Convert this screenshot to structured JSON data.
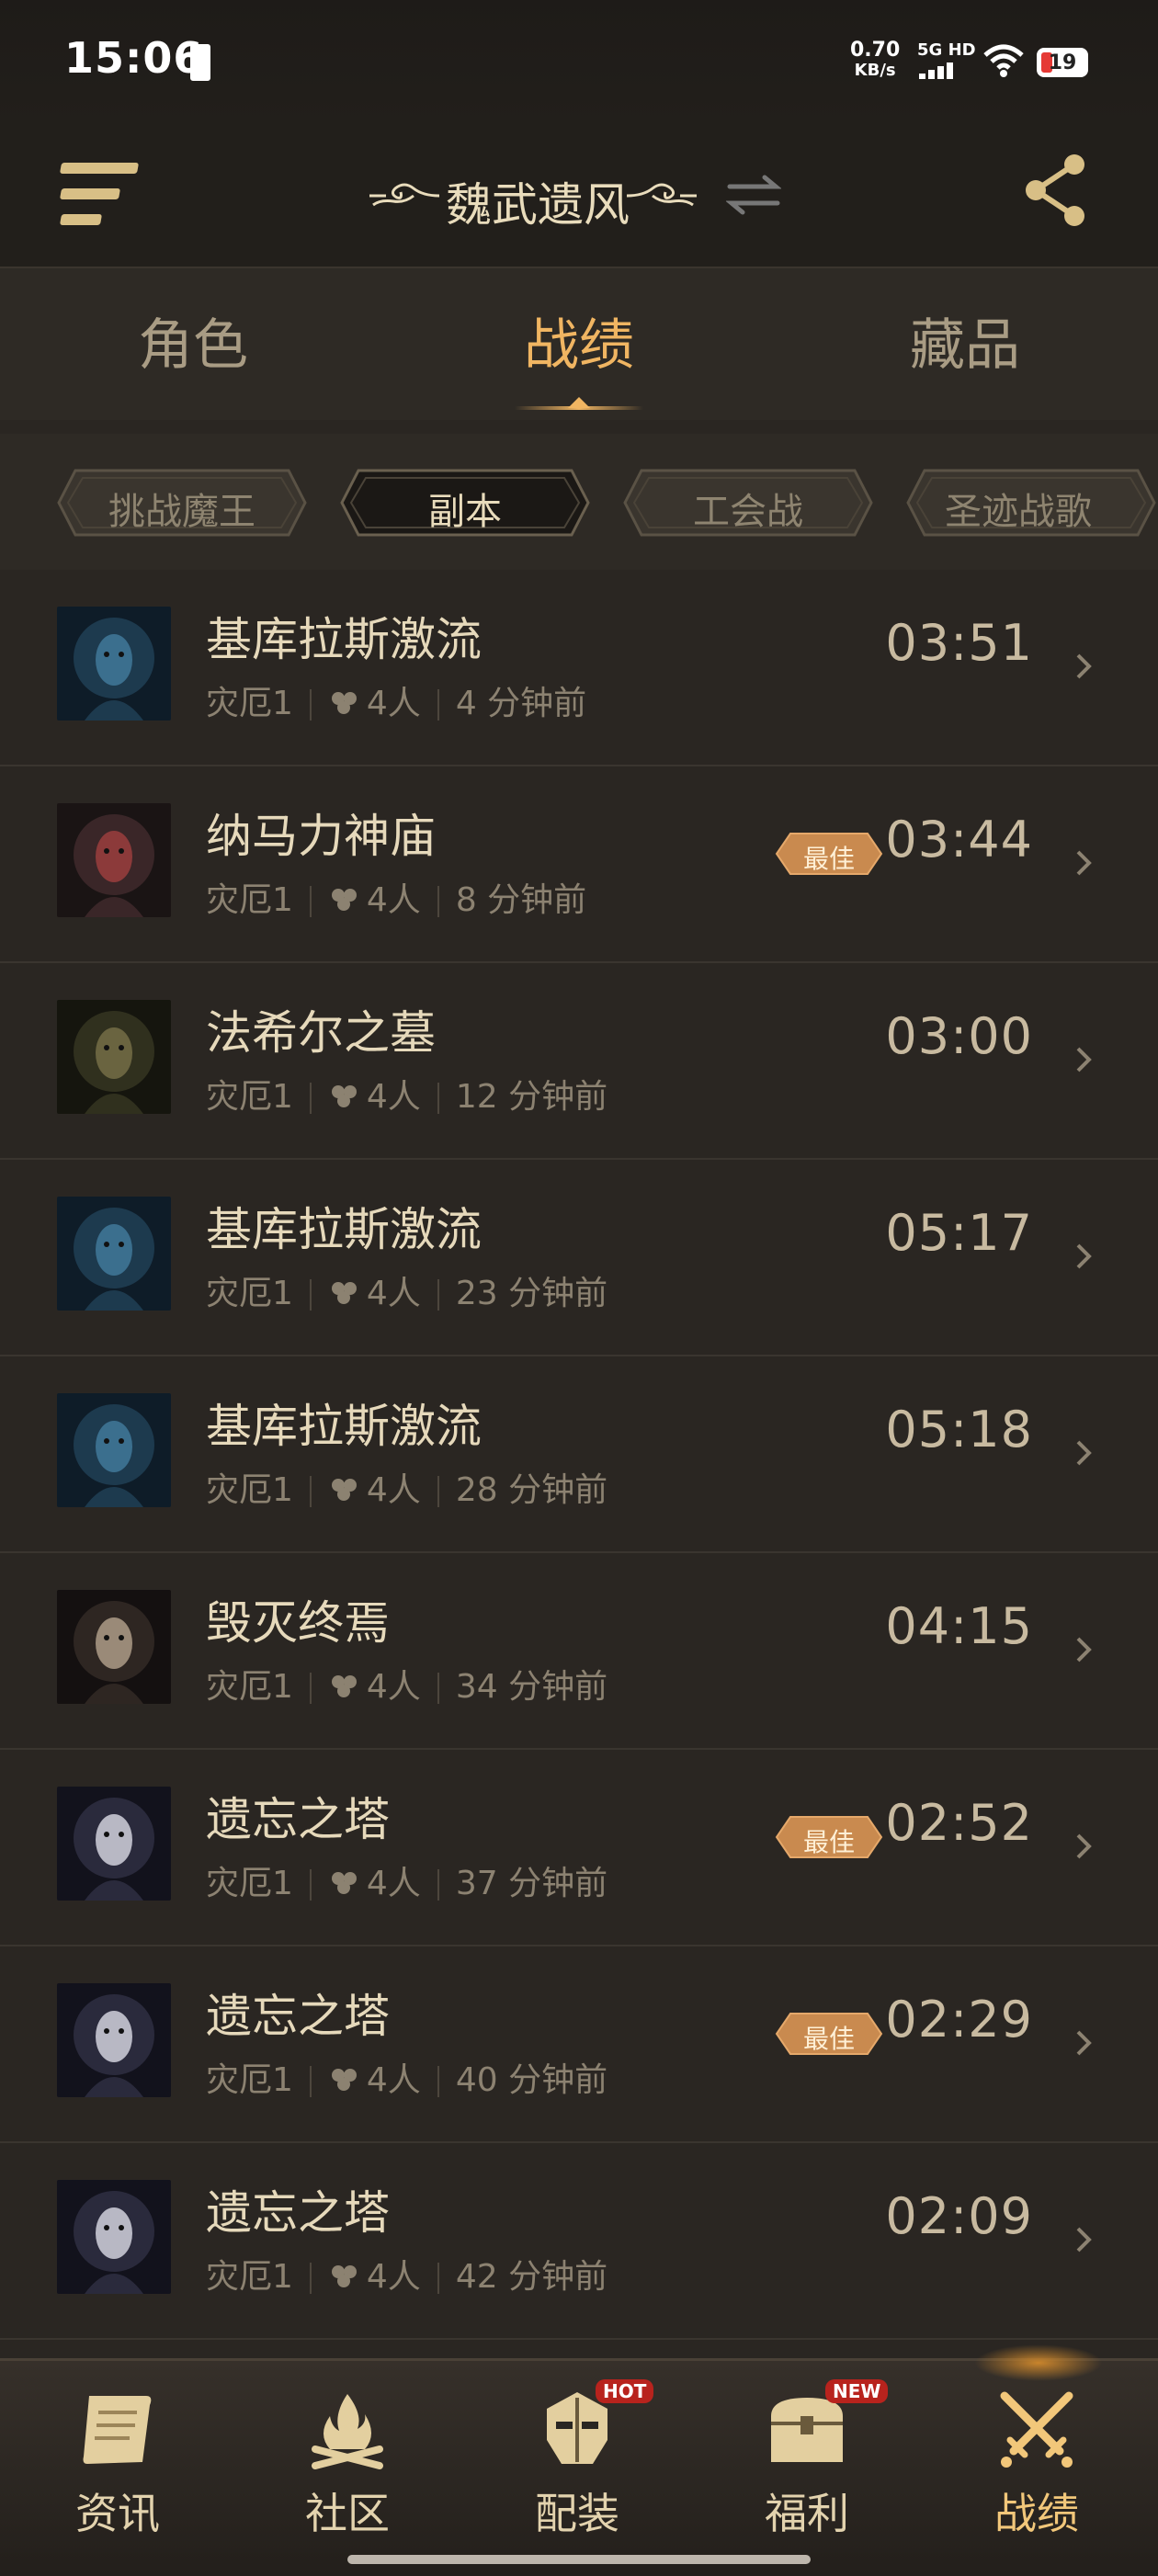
{
  "status_bar": {
    "time": "15:06",
    "net_speed_value": "0.70",
    "net_speed_unit": "KB/s",
    "network_type": "5G HD",
    "battery": "19"
  },
  "header": {
    "title": "魏武遗风",
    "icons": [
      "menu-icon",
      "swap-icon",
      "share-icon"
    ]
  },
  "main_tabs": [
    {
      "label": "角色",
      "active": false
    },
    {
      "label": "战绩",
      "active": true
    },
    {
      "label": "藏品",
      "active": false
    }
  ],
  "filter_chips": [
    {
      "label": "挑战魔王",
      "active": false
    },
    {
      "label": "副本",
      "active": true
    },
    {
      "label": "工会战",
      "active": false
    },
    {
      "label": "圣迹战歌",
      "active": false
    }
  ],
  "records": [
    {
      "name": "基库拉斯激流",
      "difficulty": "灾厄1",
      "players": "4人",
      "ago": "4 分钟前",
      "time": "03:51",
      "best": false,
      "best_label": ""
    },
    {
      "name": "纳马力神庙",
      "difficulty": "灾厄1",
      "players": "4人",
      "ago": "8 分钟前",
      "time": "03:44",
      "best": true,
      "best_label": "最佳"
    },
    {
      "name": "法希尔之墓",
      "difficulty": "灾厄1",
      "players": "4人",
      "ago": "12 分钟前",
      "time": "03:00",
      "best": false,
      "best_label": ""
    },
    {
      "name": "基库拉斯激流",
      "difficulty": "灾厄1",
      "players": "4人",
      "ago": "23 分钟前",
      "time": "05:17",
      "best": false,
      "best_label": ""
    },
    {
      "name": "基库拉斯激流",
      "difficulty": "灾厄1",
      "players": "4人",
      "ago": "28 分钟前",
      "time": "05:18",
      "best": false,
      "best_label": ""
    },
    {
      "name": "毁灭终焉",
      "difficulty": "灾厄1",
      "players": "4人",
      "ago": "34 分钟前",
      "time": "04:15",
      "best": false,
      "best_label": ""
    },
    {
      "name": "遗忘之塔",
      "difficulty": "灾厄1",
      "players": "4人",
      "ago": "37 分钟前",
      "time": "02:52",
      "best": true,
      "best_label": "最佳"
    },
    {
      "name": "遗忘之塔",
      "difficulty": "灾厄1",
      "players": "4人",
      "ago": "40 分钟前",
      "time": "02:29",
      "best": true,
      "best_label": "最佳"
    },
    {
      "name": "遗忘之塔",
      "difficulty": "灾厄1",
      "players": "4人",
      "ago": "42 分钟前",
      "time": "02:09",
      "best": false,
      "best_label": ""
    }
  ],
  "bottom_nav": [
    {
      "label": "资讯",
      "icon": "scroll-icon",
      "tag": "",
      "active": false
    },
    {
      "label": "社区",
      "icon": "campfire-icon",
      "tag": "",
      "active": false
    },
    {
      "label": "配装",
      "icon": "helmet-icon",
      "tag": "HOT",
      "active": false
    },
    {
      "label": "福利",
      "icon": "chest-icon",
      "tag": "NEW",
      "active": false
    },
    {
      "label": "战绩",
      "icon": "crossed-swords-icon",
      "tag": "",
      "active": true
    }
  ],
  "colors": {
    "background": "#2a2622",
    "accent": "#f0b562",
    "best_badge": "#c98a4f",
    "text": "#e6d9bb",
    "muted_text": "#8c8271"
  }
}
